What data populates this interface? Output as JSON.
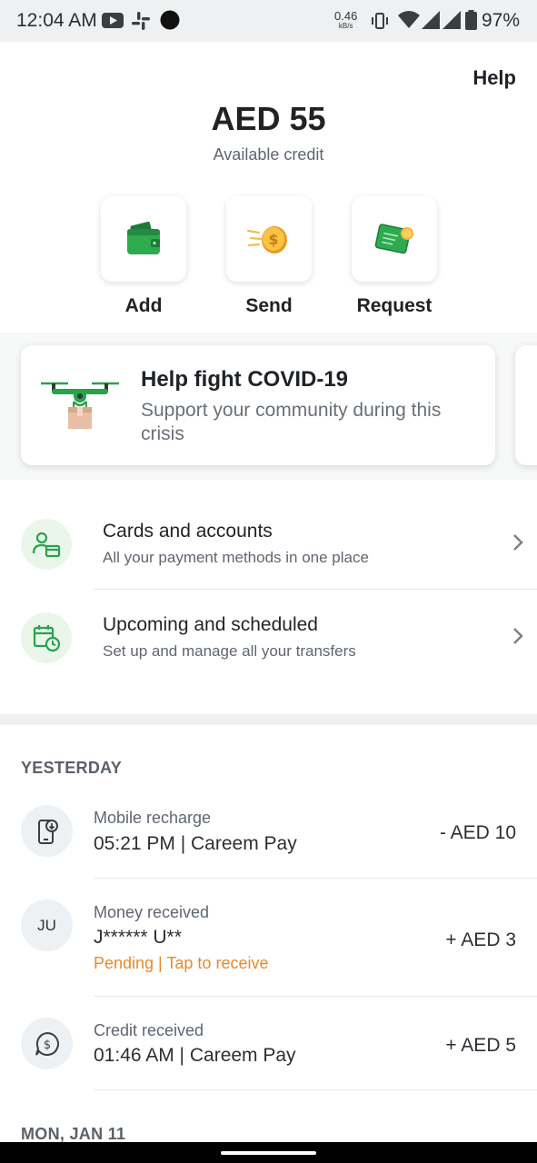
{
  "status_bar": {
    "time": "12:04 AM",
    "net_speed": "0.46",
    "net_unit": "kB/s",
    "battery": "97%",
    "icons": [
      "youtube-icon",
      "slack-icon",
      "dot-icon",
      "vibrate-icon",
      "wifi-icon",
      "signal-icon",
      "signal-icon",
      "battery-icon"
    ]
  },
  "header": {
    "help": "Help"
  },
  "balance": {
    "amount": "AED 55",
    "label": "Available credit"
  },
  "actions": [
    {
      "label": "Add",
      "icon": "wallet-icon"
    },
    {
      "label": "Send",
      "icon": "coin-icon"
    },
    {
      "label": "Request",
      "icon": "envelope-money-icon"
    }
  ],
  "promo": {
    "title": "Help fight COVID-19",
    "description": "Support your community during this crisis",
    "icon": "drone-delivery-icon"
  },
  "menu": [
    {
      "title": "Cards and accounts",
      "subtitle": "All your payment methods in one place",
      "icon": "person-card-icon"
    },
    {
      "title": "Upcoming and scheduled",
      "subtitle": "Set up and manage all your transfers",
      "icon": "calendar-clock-icon"
    }
  ],
  "sections": {
    "yesterday": "YESTERDAY",
    "next": "MON, JAN 11"
  },
  "transactions": [
    {
      "type": "Mobile recharge",
      "main": "05:21 PM | Careem Pay",
      "amount": "- AED 10",
      "icon": "phone-recharge-icon"
    },
    {
      "type": "Money received",
      "main": "J****** U**",
      "pending": "Pending | Tap to receive",
      "amount": "+ AED 3",
      "initials": "JU"
    },
    {
      "type": "Credit received",
      "main": "01:46 AM | Careem Pay",
      "amount": "+ AED 5",
      "icon": "dollar-chat-icon"
    }
  ],
  "colors": {
    "accent_green": "#27a34a",
    "pending_orange": "#e8892a"
  }
}
